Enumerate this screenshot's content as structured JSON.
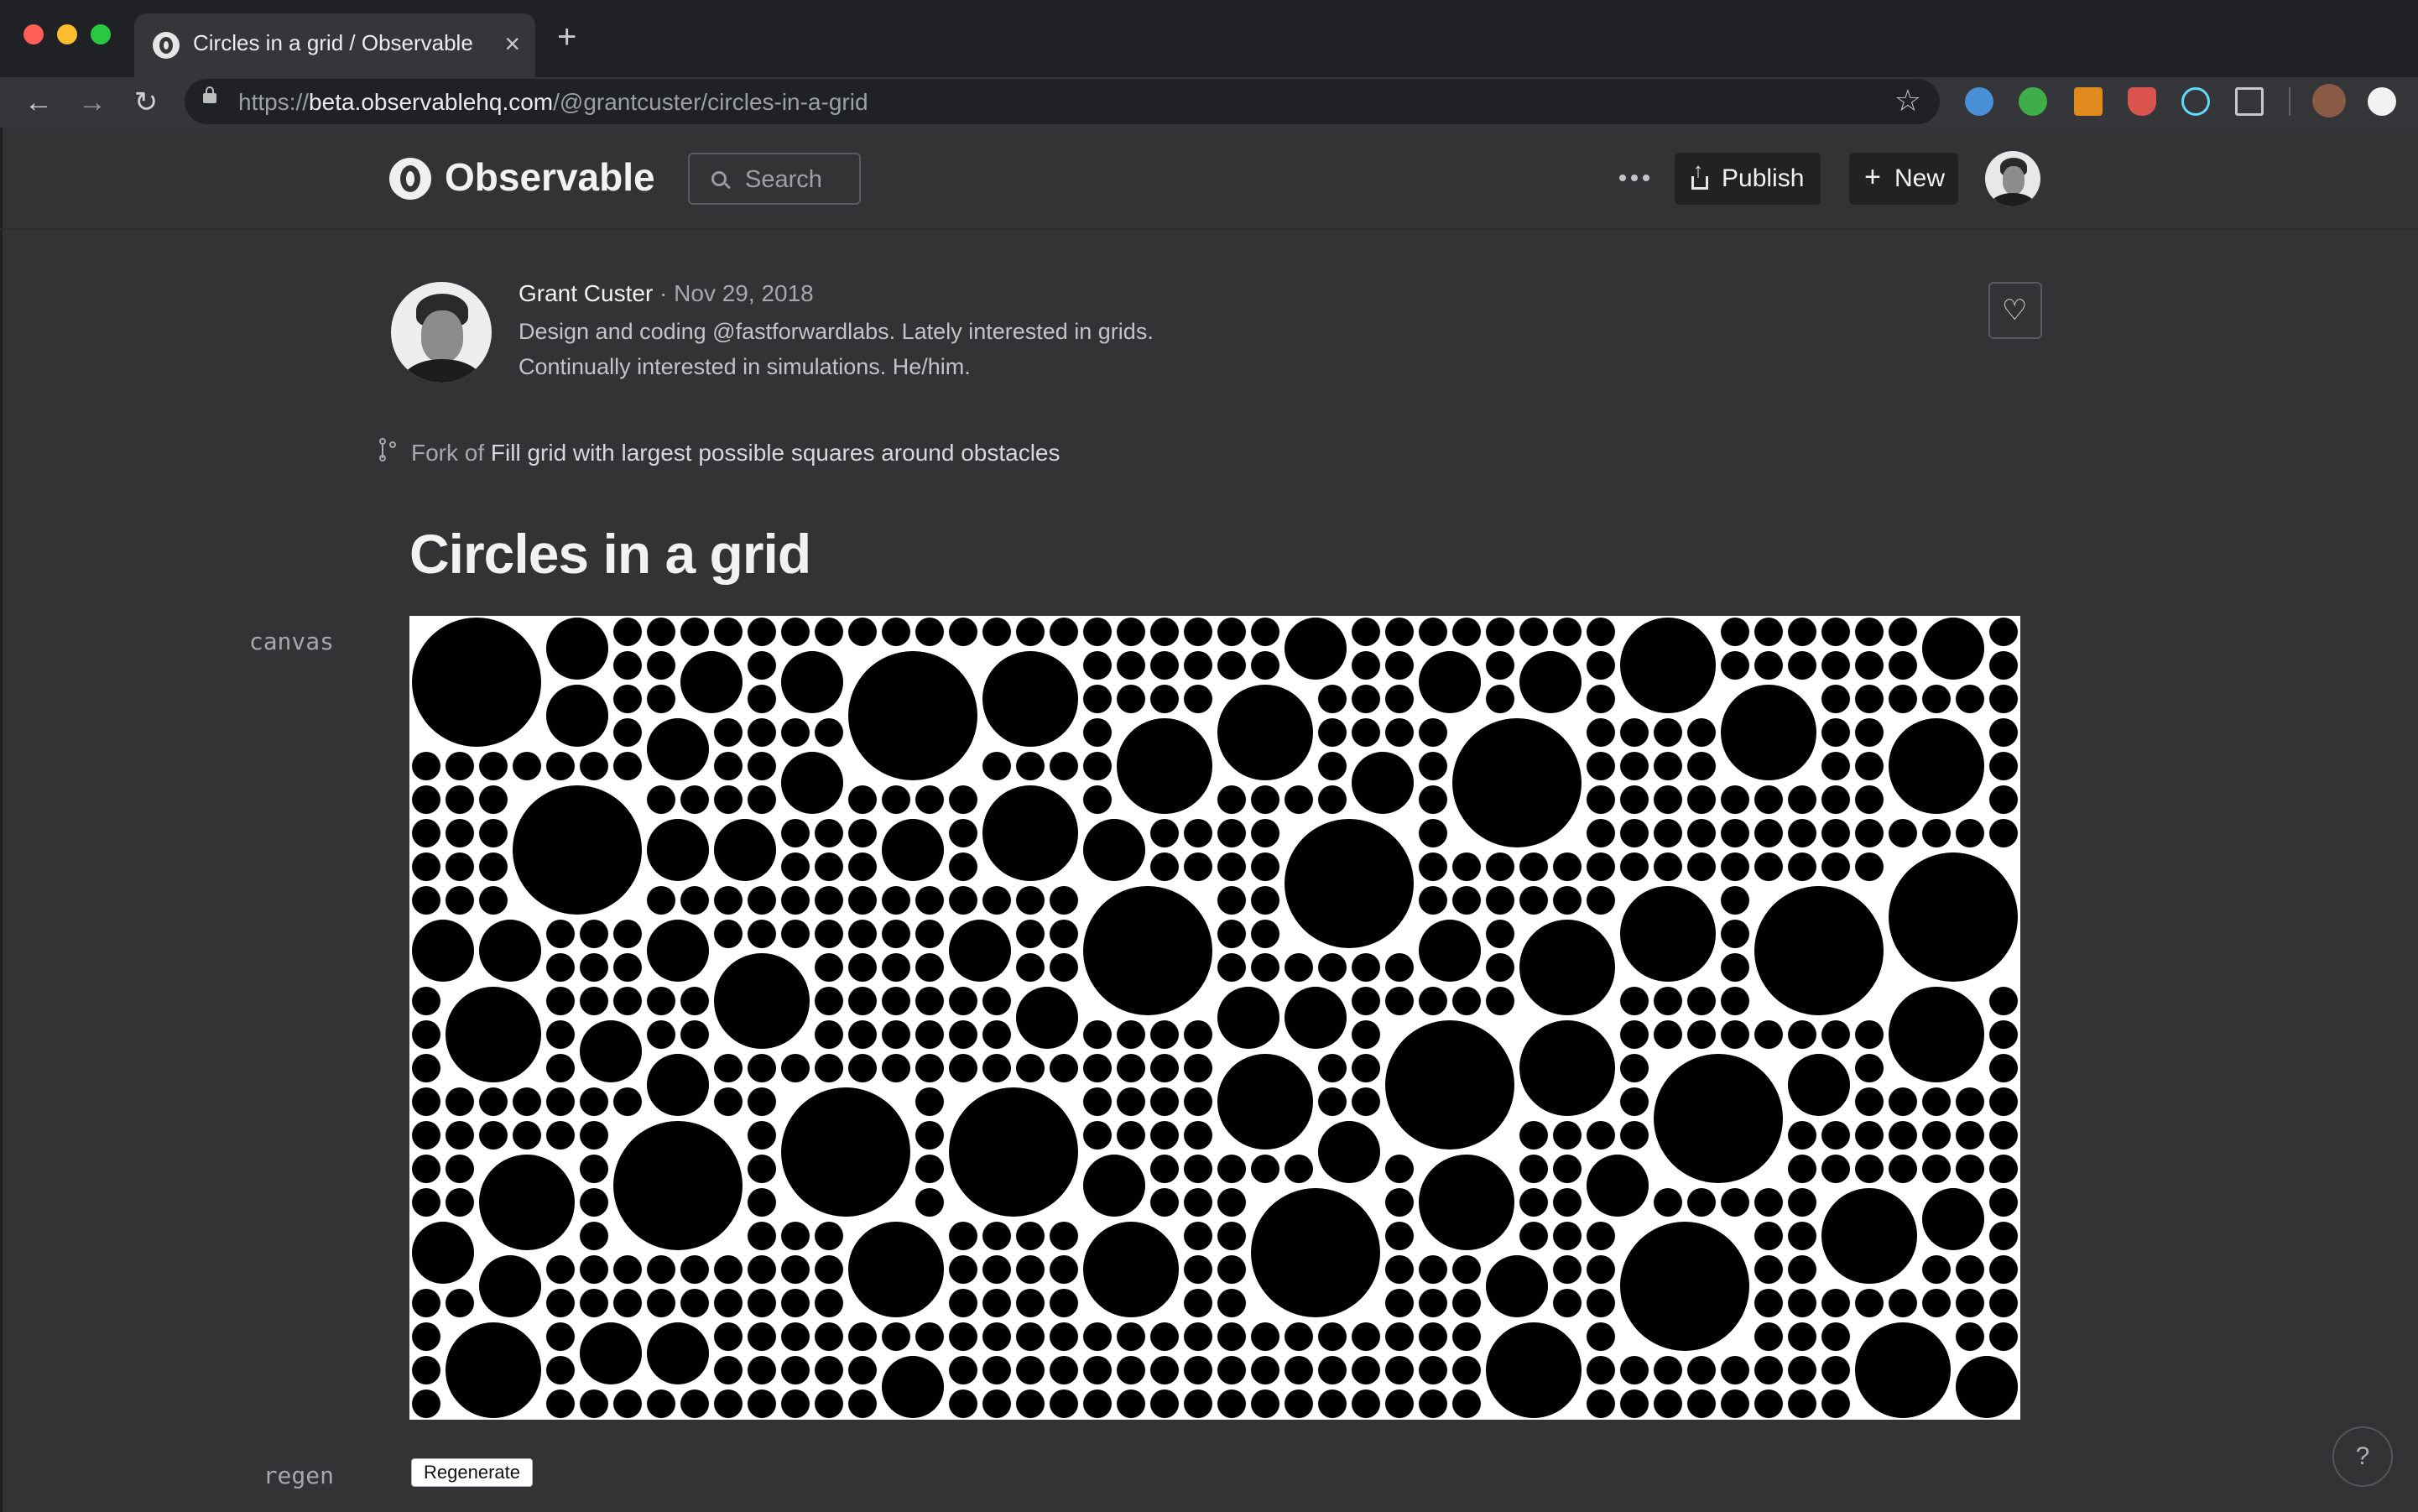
{
  "browser": {
    "tab_title": "Circles in a grid / Observable",
    "url_scheme": "https://",
    "url_host": "beta.observablehq.com",
    "url_path": "/@grantcuster/circles-in-a-grid"
  },
  "header": {
    "logo_text": "Observable",
    "search_placeholder": "Search",
    "publish_label": "Publish",
    "new_label": "New"
  },
  "author": {
    "name": "Grant Custer",
    "date_sep_and_date": " · Nov 29, 2018",
    "bio_line_1": "Design and coding @fastforwardlabs. Lately interested in grids.",
    "bio_line_2": "Continually interested in simulations. He/him."
  },
  "fork": {
    "prefix": "Fork of ",
    "link": "Fill grid with largest possible squares around obstacles"
  },
  "notebook": {
    "title": "Circles in a grid",
    "cell_canvas_label": "canvas",
    "cell_regen_label": "regen",
    "regenerate_button": "Regenerate",
    "help_label": "?"
  },
  "colors": {
    "page_bg": "#333336",
    "circle_fill": "#000000",
    "canvas_bg": "#ffffff"
  }
}
